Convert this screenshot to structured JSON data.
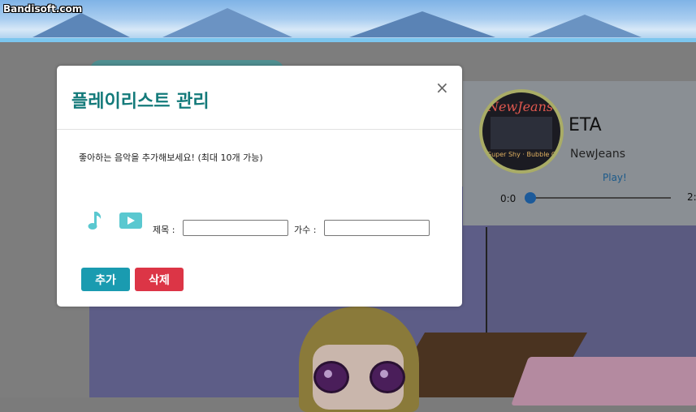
{
  "watermark": "Bandisoft.com",
  "player": {
    "album_art_title": "NewJeans",
    "album_art_subtitle": "Super Shy · Bubble Gum",
    "song_title": "ETA",
    "artist": "NewJeans",
    "play_label": "Play!",
    "time_current": "0:0",
    "time_total": "2:",
    "progress": 0
  },
  "modal": {
    "title": "플레이리스트 관리",
    "close_glyph": "×",
    "description": "좋아하는 음악을 추가해보세요! (최대 10개 가능)",
    "title_label": "제목 :",
    "title_value": "",
    "singer_label": "가수 :",
    "singer_value": "",
    "add_button": "추가",
    "delete_button": "삭제",
    "icons": [
      "music-note-icon",
      "play-icon"
    ]
  },
  "colors": {
    "accent": "#137a7a",
    "add_button": "#1a9bb0",
    "delete_button": "#dc3546",
    "icon": "#5ac8d0"
  }
}
